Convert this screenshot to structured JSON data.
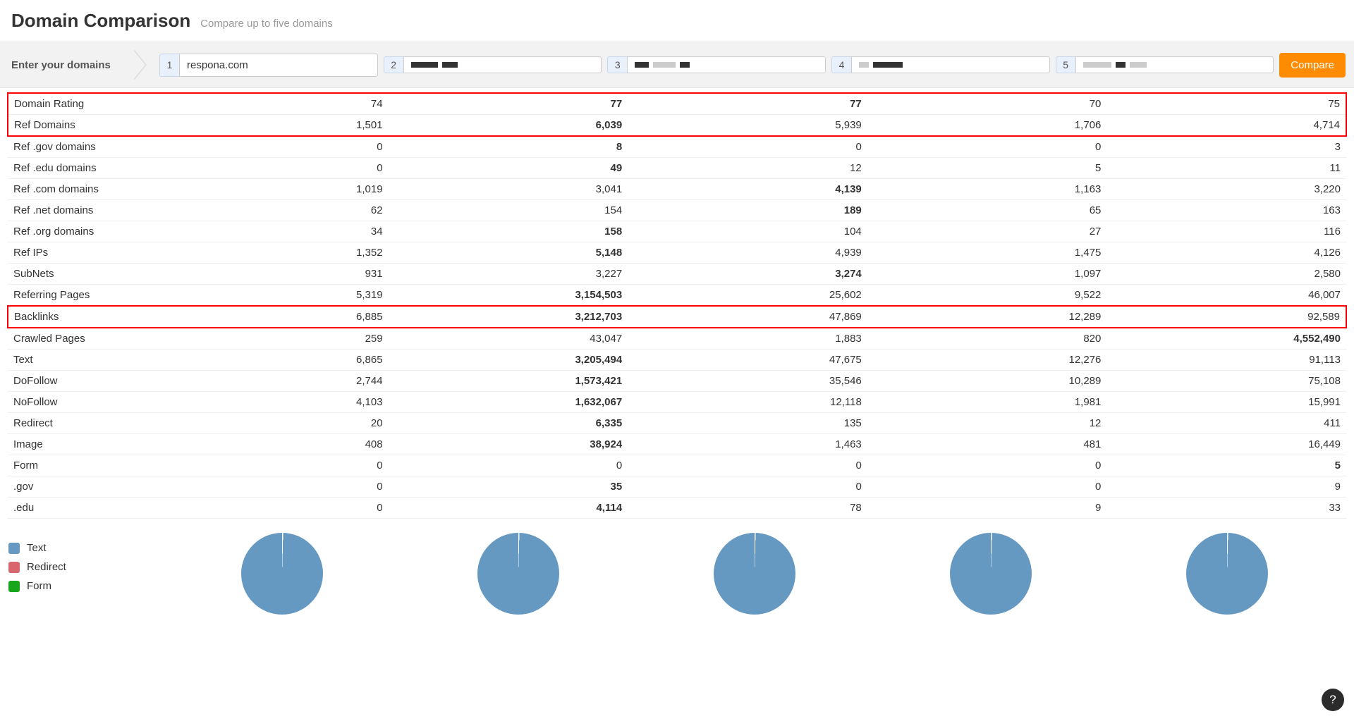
{
  "header": {
    "title": "Domain Comparison",
    "subtitle": "Compare up to five domains"
  },
  "inputs": {
    "label": "Enter your domains",
    "domains": [
      "respona.com",
      "",
      "",
      "",
      ""
    ],
    "compare_label": "Compare"
  },
  "rows": [
    {
      "metric": "Domain Rating",
      "v": [
        "74",
        "77",
        "77",
        "70",
        "75"
      ],
      "bold": [
        false,
        true,
        true,
        false,
        false
      ],
      "hl": "toprow"
    },
    {
      "metric": "Ref Domains",
      "v": [
        "1,501",
        "6,039",
        "5,939",
        "1,706",
        "4,714"
      ],
      "bold": [
        false,
        true,
        false,
        false,
        false
      ],
      "hl": "botrow"
    },
    {
      "metric": "Ref .gov domains",
      "v": [
        "0",
        "8",
        "0",
        "0",
        "3"
      ],
      "bold": [
        false,
        true,
        false,
        false,
        false
      ]
    },
    {
      "metric": "Ref .edu domains",
      "v": [
        "0",
        "49",
        "12",
        "5",
        "11"
      ],
      "bold": [
        false,
        true,
        false,
        false,
        false
      ]
    },
    {
      "metric": "Ref .com domains",
      "v": [
        "1,019",
        "3,041",
        "4,139",
        "1,163",
        "3,220"
      ],
      "bold": [
        false,
        false,
        true,
        false,
        false
      ]
    },
    {
      "metric": "Ref .net domains",
      "v": [
        "62",
        "154",
        "189",
        "65",
        "163"
      ],
      "bold": [
        false,
        false,
        true,
        false,
        false
      ]
    },
    {
      "metric": "Ref .org domains",
      "v": [
        "34",
        "158",
        "104",
        "27",
        "116"
      ],
      "bold": [
        false,
        true,
        false,
        false,
        false
      ]
    },
    {
      "metric": "Ref IPs",
      "v": [
        "1,352",
        "5,148",
        "4,939",
        "1,475",
        "4,126"
      ],
      "bold": [
        false,
        true,
        false,
        false,
        false
      ]
    },
    {
      "metric": "SubNets",
      "v": [
        "931",
        "3,227",
        "3,274",
        "1,097",
        "2,580"
      ],
      "bold": [
        false,
        false,
        true,
        false,
        false
      ]
    },
    {
      "metric": "Referring Pages",
      "v": [
        "5,319",
        "3,154,503",
        "25,602",
        "9,522",
        "46,007"
      ],
      "bold": [
        false,
        true,
        false,
        false,
        false
      ]
    },
    {
      "metric": "Backlinks",
      "v": [
        "6,885",
        "3,212,703",
        "47,869",
        "12,289",
        "92,589"
      ],
      "bold": [
        false,
        true,
        false,
        false,
        false
      ],
      "hl": "single"
    },
    {
      "metric": "Crawled Pages",
      "v": [
        "259",
        "43,047",
        "1,883",
        "820",
        "4,552,490"
      ],
      "bold": [
        false,
        false,
        false,
        false,
        true
      ]
    },
    {
      "metric": "Text",
      "v": [
        "6,865",
        "3,205,494",
        "47,675",
        "12,276",
        "91,113"
      ],
      "bold": [
        false,
        true,
        false,
        false,
        false
      ]
    },
    {
      "metric": "DoFollow",
      "v": [
        "2,744",
        "1,573,421",
        "35,546",
        "10,289",
        "75,108"
      ],
      "bold": [
        false,
        true,
        false,
        false,
        false
      ]
    },
    {
      "metric": "NoFollow",
      "v": [
        "4,103",
        "1,632,067",
        "12,118",
        "1,981",
        "15,991"
      ],
      "bold": [
        false,
        true,
        false,
        false,
        false
      ]
    },
    {
      "metric": "Redirect",
      "v": [
        "20",
        "6,335",
        "135",
        "12",
        "411"
      ],
      "bold": [
        false,
        true,
        false,
        false,
        false
      ]
    },
    {
      "metric": "Image",
      "v": [
        "408",
        "38,924",
        "1,463",
        "481",
        "16,449"
      ],
      "bold": [
        false,
        true,
        false,
        false,
        false
      ]
    },
    {
      "metric": "Form",
      "v": [
        "0",
        "0",
        "0",
        "0",
        "5"
      ],
      "bold": [
        false,
        false,
        false,
        false,
        true
      ]
    },
    {
      "metric": ".gov",
      "v": [
        "0",
        "35",
        "0",
        "0",
        "9"
      ],
      "bold": [
        false,
        true,
        false,
        false,
        false
      ]
    },
    {
      "metric": ".edu",
      "v": [
        "0",
        "4,114",
        "78",
        "9",
        "33"
      ],
      "bold": [
        false,
        true,
        false,
        false,
        false
      ]
    }
  ],
  "legend": [
    {
      "label": "Text",
      "color": "#6699c2"
    },
    {
      "label": "Redirect",
      "color": "#d9656e"
    },
    {
      "label": "Form",
      "color": "#17a61b"
    }
  ],
  "help": "?",
  "chart_data": {
    "type": "pie",
    "note": "Five identical donut/pie charts, one per domain column, showing backlink type composition. Visually each is ~100% Text with a thin white tick at 12 o'clock; other segments not discernible at this rendering size.",
    "series_labels": [
      "Text",
      "Redirect",
      "Form"
    ],
    "per_domain_est_percent": [
      [
        100,
        0,
        0
      ],
      [
        100,
        0,
        0
      ],
      [
        100,
        0,
        0
      ],
      [
        100,
        0,
        0
      ],
      [
        100,
        0,
        0
      ]
    ]
  }
}
